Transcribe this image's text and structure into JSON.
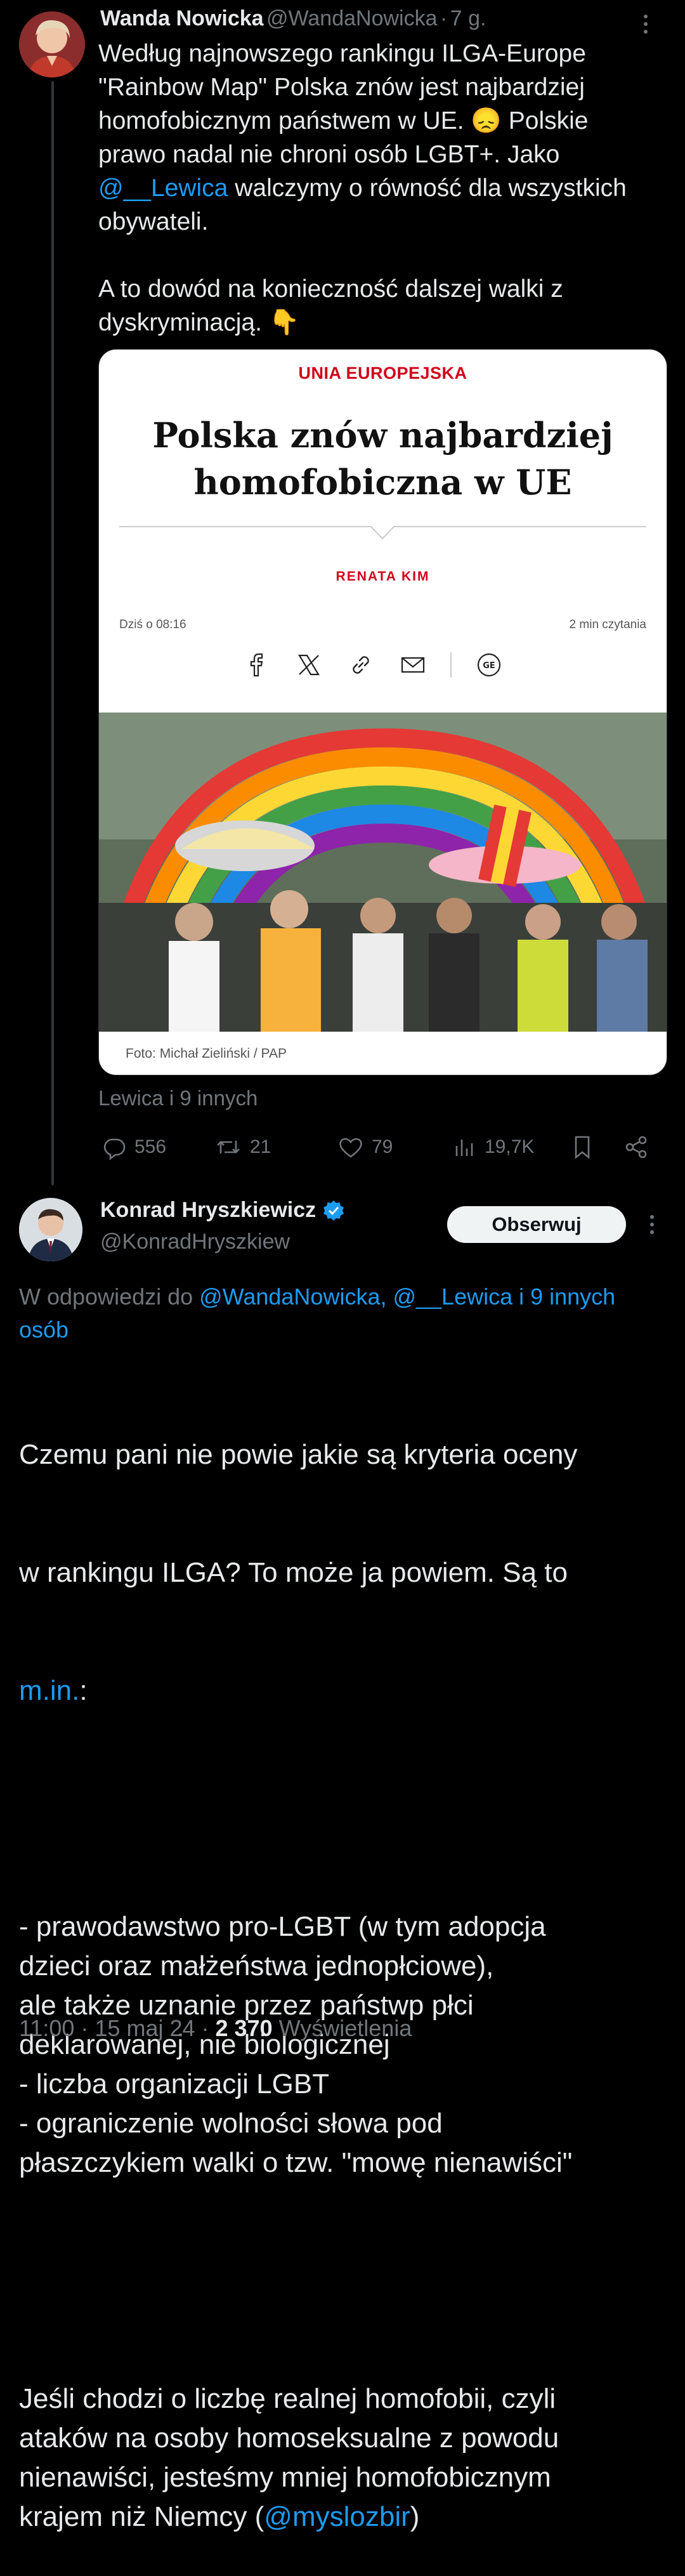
{
  "tweet1": {
    "author_name": "Wanda Nowicka",
    "handle": "@WandaNowicka",
    "separator": "·",
    "time_ago": "7 g.",
    "text_lines": [
      "Według najnowszego rankingu ILGA-Europe",
      "\"Rainbow Map\" Polska znów jest najbardziej",
      "homofobicznym państwem w UE. 😞 Polskie",
      "prawo nadal nie chroni osób LGBT+.  Jako"
    ],
    "mention_lewica": "@__Lewica",
    "text_after_mention": " walczymy o równość dla wszystkich",
    "text_line_6": "obywateli.",
    "text_line_7": "A to dowód na konieczność dalszej walki z",
    "text_line_8": "dyskryminacją. 👇",
    "card": {
      "section": "UNIA EUROPEJSKA",
      "title_line1": "Polska znów najbardziej",
      "title_line2": "homofobiczna w UE",
      "author": "RENATA KIM",
      "date": "Dziś o 08:16",
      "read_time": "2 min czytania",
      "photo_caption": "Foto: Michał Zieliński / PAP"
    },
    "tagged": "Lewica i 9 innych",
    "stats": {
      "replies": "556",
      "reposts": "21",
      "likes": "79",
      "views": "19,7K"
    }
  },
  "tweet2": {
    "author_name": "Konrad Hryszkiewicz",
    "handle": "@KonradHryszkiew",
    "follow_label": "Obserwuj",
    "reply_prefix": "W odpowiedzi do ",
    "reply_targets_line1": "@WandaNowicka, @__Lewica i 9 innych",
    "reply_targets_line2": "osób",
    "text_line1": "Czemu pani nie powie jakie są kryteria oceny",
    "text_line2": "w rankingu ILGA? To może ja powiem. Są to",
    "link_min": "m.in.",
    "text_line3_after": ":",
    "list_block": "- prawodawstwo pro-LGBT (w tym adopcja\ndzieci oraz małżeństwa jednopłciowe),\nale także uznanie przez państwp płci\ndeklarowanej, nie biologicznej\n- liczba organizacji LGBT\n- ograniczenie wolności słowa pod\npłaszczykiem walki o tzw. \"mowę nienawiści\"",
    "closing_block": "Jeśli chodzi o liczbę realnej homofobii, czyli\nataków na osoby homoseksualne z powodu\nnienawiści, jesteśmy mniej homofobicznym\nkrajem niż Niemcy (",
    "mention_myslozbir": "@myslozbir",
    "closing_paren": ")",
    "timestamp": "11:00 · 15 maj 24 · ",
    "views_count": "2 370",
    "views_label": " Wyświetlenia"
  },
  "colors": {
    "background": "#000000",
    "text": "#e7e9ea",
    "muted": "#71767b",
    "link": "#1d9bf0",
    "verified": "#1d9bf0",
    "headline_red": "#d0021b"
  }
}
